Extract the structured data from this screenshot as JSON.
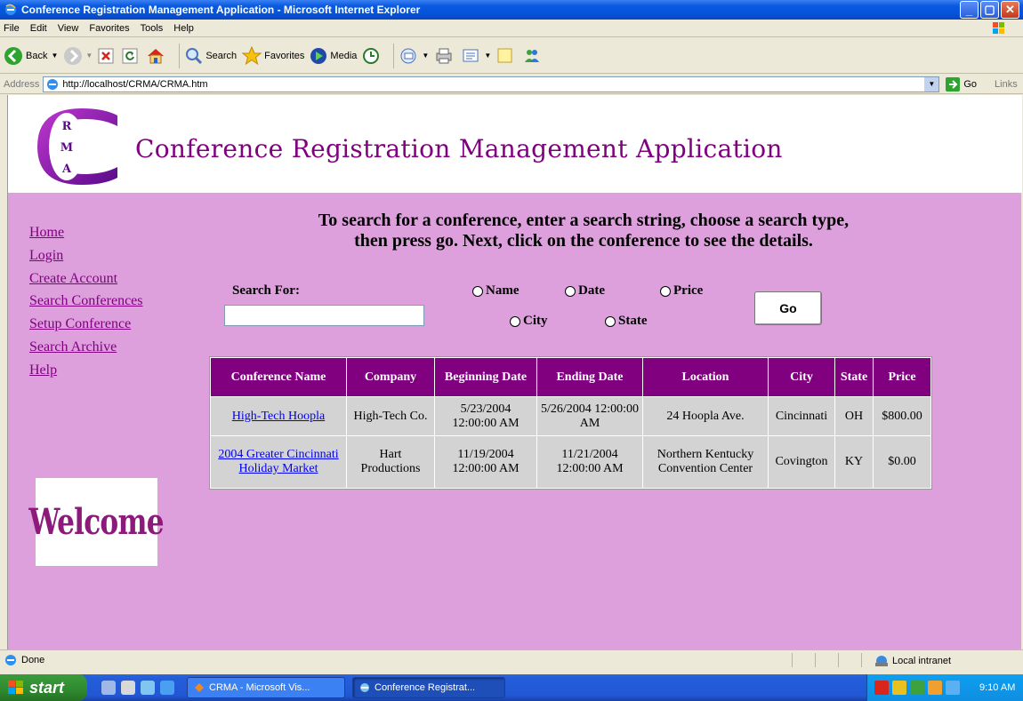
{
  "window": {
    "title": "Conference Registration Management Application - Microsoft Internet Explorer"
  },
  "menubar": [
    "File",
    "Edit",
    "View",
    "Favorites",
    "Tools",
    "Help"
  ],
  "toolbar": {
    "back": "Back",
    "search": "Search",
    "favorites": "Favorites",
    "media": "Media"
  },
  "address": {
    "label": "Address",
    "url": "http://localhost/CRMA/CRMA.htm",
    "go": "Go",
    "links": "Links"
  },
  "page": {
    "logo_letters": [
      "R",
      "M",
      "A"
    ],
    "title": "Conference Registration Management Application",
    "nav": [
      "Home",
      "Login",
      "Create Account",
      "Search Conferences",
      "Setup Conference",
      "Search Archive",
      "Help"
    ],
    "welcome": "Welcome",
    "instructions_line1": "To search for a conference, enter a search string, choose a search type,",
    "instructions_line2": "then press go. Next, click on the conference to see the details.",
    "search_label": "Search For:",
    "search_value": "",
    "radio_options": [
      "Name",
      "Date",
      "Price",
      "City",
      "State"
    ],
    "go_button": "Go"
  },
  "results": {
    "columns": [
      "Conference Name",
      "Company",
      "Beginning Date",
      "Ending Date",
      "Location",
      "City",
      "State",
      "Price"
    ],
    "rows": [
      {
        "name": "High-Tech Hoopla",
        "company": "High-Tech Co.",
        "begin": "5/23/2004 12:00:00 AM",
        "end": "5/26/2004 12:00:00 AM",
        "location": "24 Hoopla Ave.",
        "city": "Cincinnati",
        "state": "OH",
        "price": "$800.00"
      },
      {
        "name": "2004 Greater Cincinnati Holiday Market",
        "company": "Hart Productions",
        "begin": "11/19/2004 12:00:00 AM",
        "end": "11/21/2004 12:00:00 AM",
        "location": "Northern Kentucky Convention Center",
        "city": "Covington",
        "state": "KY",
        "price": "$0.00"
      }
    ]
  },
  "statusbar": {
    "status": "Done",
    "zone": "Local intranet"
  },
  "taskbar": {
    "start": "start",
    "tasks": [
      "CRMA - Microsoft Vis...",
      "Conference Registrat..."
    ],
    "clock": "9:10 AM"
  },
  "colors": {
    "page_bg": "#dda0dd",
    "accent": "#800080",
    "link": "#0000ee"
  }
}
